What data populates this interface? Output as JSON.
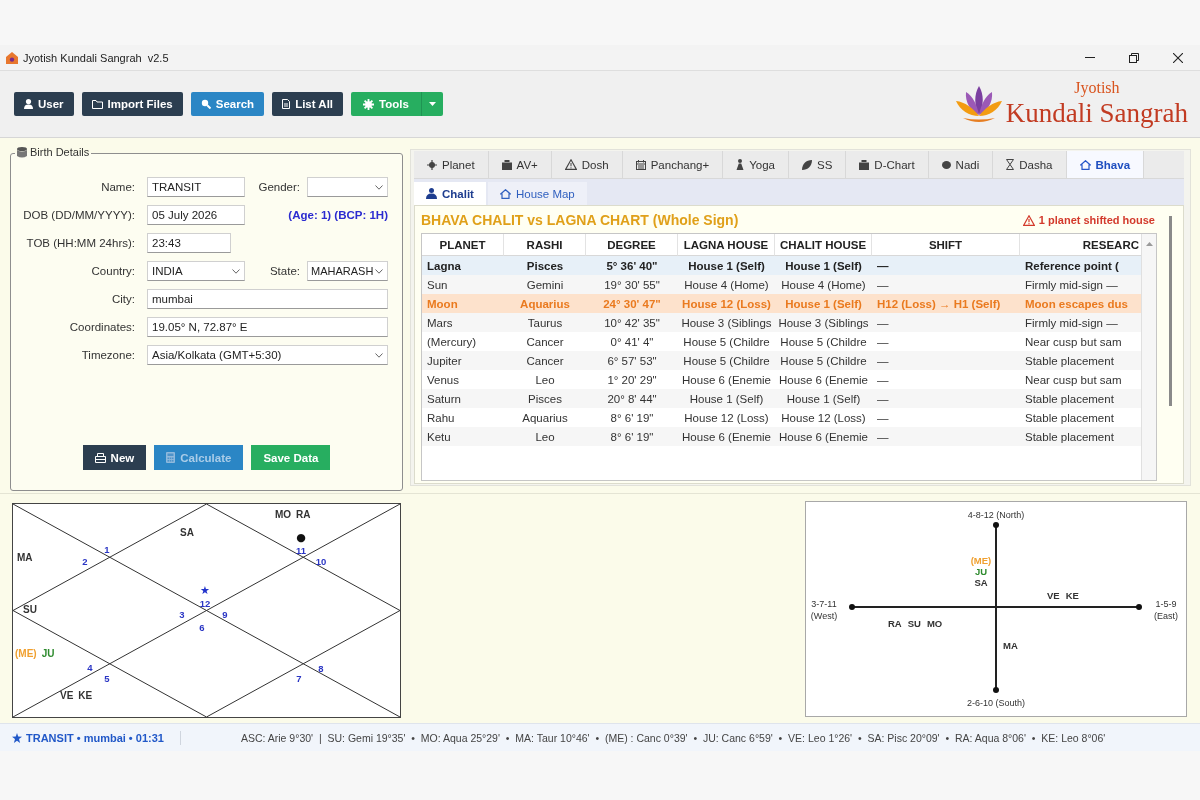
{
  "window": {
    "title": "Jyotish Kundali Sangrah  v2.5"
  },
  "toolbar": {
    "buttons": [
      {
        "label": "User",
        "kind": "dark",
        "dropdown": false
      },
      {
        "label": "Import Files",
        "kind": "dark",
        "dropdown": false
      },
      {
        "label": "Search",
        "kind": "blue",
        "dropdown": false
      },
      {
        "label": "List All",
        "kind": "dark",
        "dropdown": false
      },
      {
        "label": "Tools",
        "kind": "green",
        "dropdown": true
      }
    ]
  },
  "logo": {
    "subtitle": "Jyotish",
    "title": "Kundali Sangrah"
  },
  "birth_details": {
    "title": "Birth Details",
    "rows": [
      {
        "fields": [
          {
            "label": "Name:",
            "value": "TRANSIT",
            "kind": "text"
          },
          {
            "label": "Gender:",
            "kind": "select"
          }
        ]
      },
      {
        "fields": [
          {
            "label": "DOB (DD/MM/YYYY):",
            "value": "05 July 2026",
            "kind": "text"
          }
        ],
        "note": "(Age: 1) (BCP: 1H)"
      },
      {
        "fields": [
          {
            "label": "TOB (HH:MM 24hrs):",
            "value": "23:43",
            "kind": "short"
          }
        ]
      },
      {
        "fields": [
          {
            "label": "Country:",
            "value": "INDIA",
            "kind": "select"
          },
          {
            "label": "State:",
            "value": "MAHARASH",
            "kind": "select"
          }
        ]
      },
      {
        "fields": [
          {
            "label": "City:",
            "value": "mumbai",
            "kind": "wide"
          }
        ]
      },
      {
        "fields": [
          {
            "label": "Coordinates:",
            "value": "19.05° N, 72.87° E",
            "kind": "wide"
          }
        ]
      },
      {
        "fields": [
          {
            "label": "Timezone:",
            "value": "Asia/Kolkata (GMT+5:30)",
            "kind": "wideselect"
          }
        ]
      }
    ],
    "buttons": [
      {
        "label": "New",
        "kind": "dark",
        "disabled": false
      },
      {
        "label": "Calculate",
        "kind": "blue",
        "disabled": true
      },
      {
        "label": "Save Data",
        "kind": "green",
        "disabled": false
      }
    ]
  },
  "tabs": [
    {
      "label": "Planet",
      "selected": false
    },
    {
      "label": "AV+",
      "selected": false
    },
    {
      "label": "Dosh",
      "selected": false
    },
    {
      "label": "Panchang+",
      "selected": false
    },
    {
      "label": "Yoga",
      "selected": false
    },
    {
      "label": "SS",
      "selected": false
    },
    {
      "label": "D-Chart",
      "selected": false
    },
    {
      "label": "Nadi",
      "selected": false
    },
    {
      "label": "Dasha",
      "selected": false
    },
    {
      "label": "Bhava",
      "selected": true
    }
  ],
  "subtabs": [
    {
      "label": "Chalit",
      "selected": true
    },
    {
      "label": "House Map",
      "selected": false
    }
  ],
  "bhava": {
    "title": "BHAVA CHALIT vs LAGNA CHART (Whole Sign)",
    "alert": "1 planet shifted house",
    "table": {
      "columns": [
        "PLANET",
        "RASHI",
        "DEGREE",
        "LAGNA HOUSE",
        "CHALIT HOUSE",
        "SHIFT",
        "RESEARC"
      ],
      "rows": [
        {
          "kind": "reference",
          "cells": [
            "Lagna",
            "Pisces",
            "5° 36' 40\"",
            "House 1 (Self)",
            "House 1 (Self)",
            "—",
            "Reference point ("
          ]
        },
        {
          "kind": "normal",
          "cells": [
            "Sun",
            "Gemini",
            "19° 30' 55\"",
            "House 4 (Home)",
            "House 4 (Home)",
            "—",
            "Firmly mid-sign —"
          ]
        },
        {
          "kind": "shifted",
          "cells": [
            "Moon",
            "Aquarius",
            "24° 30' 47\"",
            "House 12 (Loss)",
            "House 1 (Self)",
            "H12 (Loss) → H1 (Self)",
            "Moon escapes dus"
          ]
        },
        {
          "kind": "normal",
          "cells": [
            "Mars",
            "Taurus",
            "10° 42' 35\"",
            "House 3 (Siblings",
            "House 3 (Siblings",
            "—",
            "Firmly mid-sign —"
          ]
        },
        {
          "kind": "normal",
          "cells": [
            "(Mercury)",
            "Cancer",
            "0° 41' 4\"",
            "House 5 (Childre",
            "House 5 (Childre",
            "—",
            "Near cusp but sam"
          ]
        },
        {
          "kind": "normal",
          "cells": [
            "Jupiter",
            "Cancer",
            "6° 57' 53\"",
            "House 5 (Childre",
            "House 5 (Childre",
            "—",
            "Stable placement"
          ]
        },
        {
          "kind": "normal",
          "cells": [
            "Venus",
            "Leo",
            "1° 20' 29\"",
            "House 6 (Enemie",
            "House 6 (Enemie",
            "—",
            "Near cusp but sam"
          ]
        },
        {
          "kind": "normal",
          "cells": [
            "Saturn",
            "Pisces",
            "20° 8' 44\"",
            "House 1 (Self)",
            "House 1 (Self)",
            "—",
            "Stable placement"
          ]
        },
        {
          "kind": "normal",
          "cells": [
            "Rahu",
            "Aquarius",
            "8° 6' 19\"",
            "House 12 (Loss)",
            "House 12 (Loss)",
            "—",
            "Stable placement"
          ]
        },
        {
          "kind": "normal",
          "cells": [
            "Ketu",
            "Leo",
            "8° 6' 19\"",
            "House 6 (Enemie",
            "House 6 (Enemie",
            "—",
            "Stable placement"
          ]
        }
      ]
    }
  },
  "lagna_chart": {
    "houses": [
      {
        "sign": "12",
        "marker": {
          "symbol": "★",
          "color": "#2233cc"
        },
        "planets": [
          {
            "name": "SA",
            "color": "#333333"
          }
        ]
      },
      {
        "sign": "1"
      },
      {
        "sign": "2",
        "planets": [
          {
            "name": "MA",
            "color": "#333333"
          }
        ]
      },
      {
        "sign": "3",
        "planets": [
          {
            "name": "SU",
            "color": "#333333"
          }
        ]
      },
      {
        "sign": "4",
        "planets": [
          {
            "name": "(ME)",
            "color": "#f0a030"
          },
          {
            "name": "JU",
            "color": "#2e8b2e"
          }
        ]
      },
      {
        "sign": "5",
        "planets": [
          {
            "name": "VE",
            "color": "#333333"
          },
          {
            "name": "KE",
            "color": "#333333"
          }
        ]
      },
      {
        "sign": "6"
      },
      {
        "sign": "7"
      },
      {
        "sign": "8"
      },
      {
        "sign": "9"
      },
      {
        "sign": "10"
      },
      {
        "sign": "11",
        "marker": {
          "symbol": "●",
          "color": "#111111"
        },
        "planets": [
          {
            "name": "MO",
            "color": "#333333"
          },
          {
            "name": "RA",
            "color": "#333333"
          }
        ]
      }
    ]
  },
  "direction_chart": {
    "directions": [
      {
        "label": "4-8-12 (North)",
        "planets": [
          {
            "name": "(ME)",
            "color": "#f0a030"
          },
          {
            "name": "JU",
            "color": "#2e8b2e"
          },
          {
            "name": "SA",
            "color": "#333333"
          }
        ]
      },
      {
        "label": "3-7-11 (West)",
        "planets": [
          {
            "name": "RA",
            "color": "#333333"
          },
          {
            "name": "SU",
            "color": "#333333"
          },
          {
            "name": "MO",
            "color": "#333333"
          }
        ]
      },
      {
        "label": "1-5-9 (East)",
        "planets": [
          {
            "name": "VE",
            "color": "#333333"
          },
          {
            "name": "KE",
            "color": "#333333"
          }
        ]
      },
      {
        "label": "2-6-10 (South)",
        "planets": [
          {
            "name": "MA",
            "color": "#333333"
          }
        ]
      }
    ]
  },
  "status_bar": {
    "profile": "TRANSIT • mumbai • 01:31",
    "positions": "ASC: Arie 9°30'  |  SU: Gemi 19°35'  •  MO: Aqua 25°29'  •  MA: Taur 10°46'  •  (ME) : Canc 0°39'  •  JU: Canc 6°59'  •  VE: Leo 1°26'  •  SA: Pisc 20°09'  •  RA: Aqua 8°06'  •  KE: Leo 8°06'"
  }
}
